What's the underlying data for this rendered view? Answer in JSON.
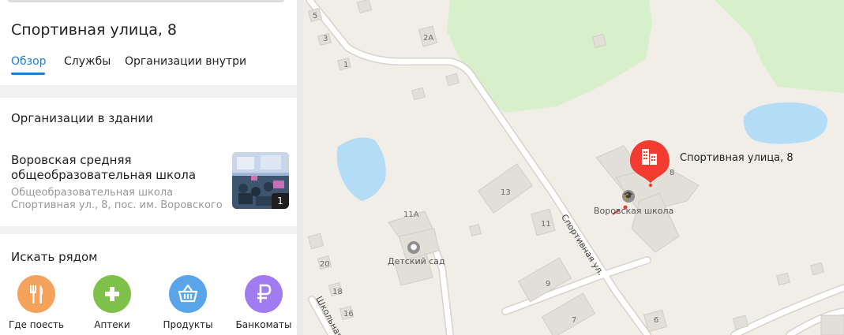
{
  "sidebar": {
    "title": "Спортивная улица, 8",
    "tabs": [
      {
        "label": "Обзор",
        "active": true
      },
      {
        "label": "Службы",
        "active": false
      },
      {
        "label": "Организации внутри",
        "active": false
      }
    ],
    "organizations": {
      "heading": "Организации в здании",
      "items": [
        {
          "name": "Воровская средняя общеобразовательная школа",
          "category": "Общеобразовательная школа",
          "address": "Спортивная ул., 8, пос. им. Воровского",
          "photo_count": "1"
        }
      ]
    },
    "nearby": {
      "heading": "Искать рядом",
      "items": [
        {
          "label": "Где поесть",
          "icon": "fork-knife-icon",
          "color": "#f5a25d"
        },
        {
          "label": "Аптеки",
          "icon": "plus-icon",
          "color": "#7ec14a"
        },
        {
          "label": "Продукты",
          "icon": "basket-icon",
          "color": "#5aa5ea"
        },
        {
          "label": "Банкоматы",
          "icon": "ruble-icon",
          "color": "#a07cf0"
        }
      ]
    }
  },
  "map": {
    "pin_title": "Спортивная улица, 8",
    "pin_icon": "building-icon",
    "pin_color": "#f23c32",
    "pois": [
      {
        "label": "Воровская школа",
        "icon": "school-icon"
      },
      {
        "label": "Детский сад",
        "icon": "kindergarten-icon"
      }
    ],
    "streets": [
      "Спортивная ул.",
      "Школьная"
    ],
    "house_numbers": [
      "5",
      "3",
      "2А",
      "1",
      "13",
      "11А",
      "11",
      "8",
      "9",
      "7",
      "6",
      "20",
      "18",
      "16"
    ]
  },
  "colors": {
    "accent": "#1a7fd6",
    "park": "#d9f0cf",
    "water": "#b3dbf7",
    "building": "#e1ddd7"
  }
}
